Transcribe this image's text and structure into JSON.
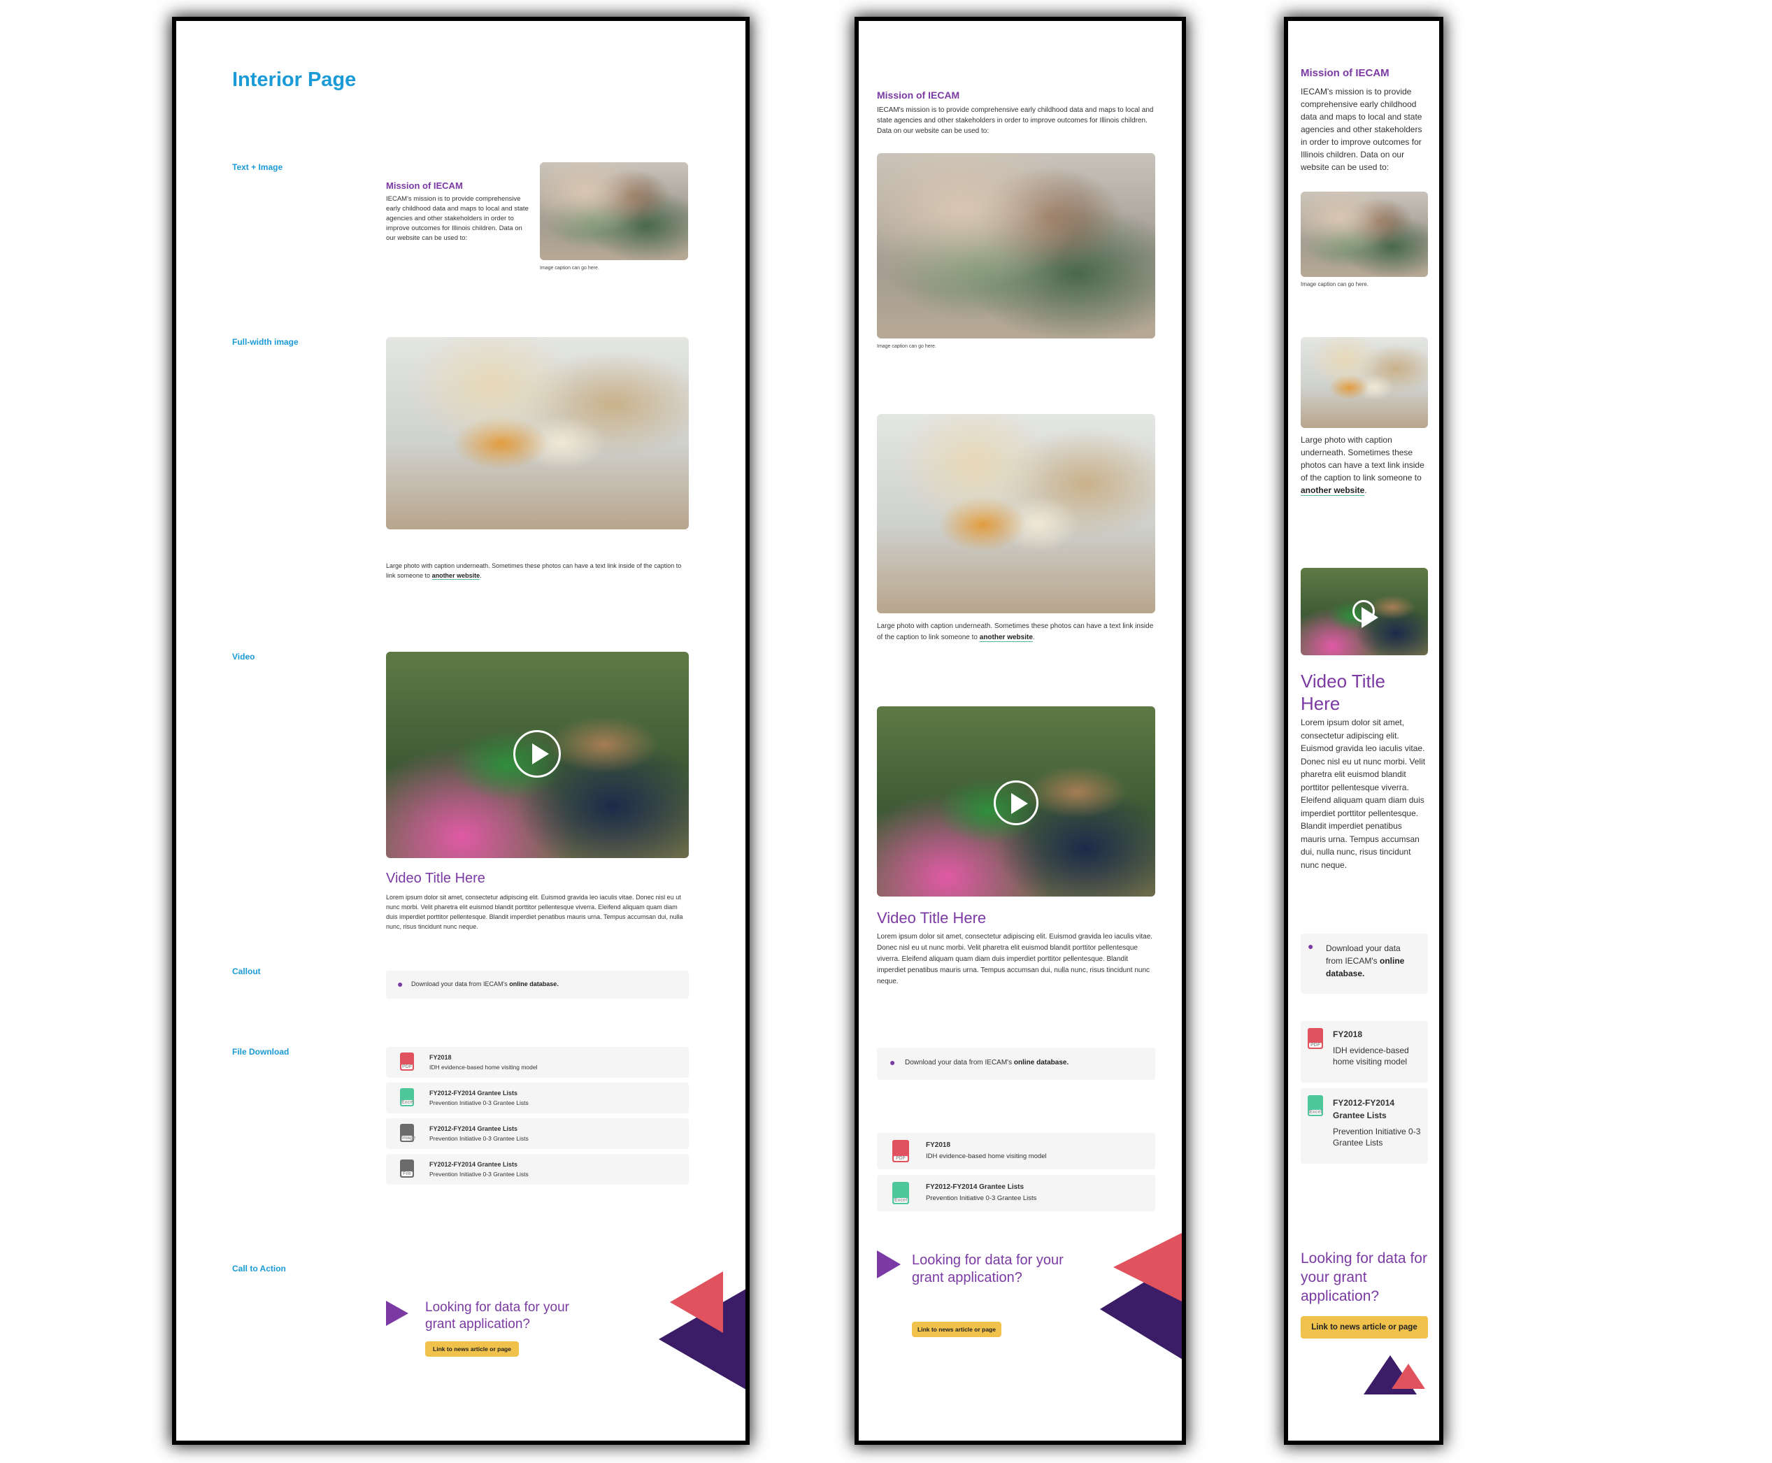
{
  "page_title": "Interior Page",
  "labels": {
    "text_image": "Text + Image",
    "full_width_image": "Full-width image",
    "video": "Video",
    "callout": "Callout",
    "file_download": "File Download",
    "call_to_action": "Call to Action"
  },
  "mission": {
    "title": "Mission of IECAM",
    "body": "IECAM's mission is to provide comprehensive early childhood data and maps to local and state agencies and other stakeholders in order to improve outcomes for Illinois children. Data on our website can be used to:",
    "caption": "Image caption can go here."
  },
  "full_image": {
    "caption_prefix": "Large photo with caption underneath. Sometimes these photos can have a text link inside of the caption to link someone to",
    "caption_link": "another website",
    "caption_suffix": "."
  },
  "video": {
    "title": "Video Title Here",
    "body": "Lorem ipsum dolor sit amet, consectetur adipiscing elit. Euismod gravida leo iaculis vitae. Donec nisl eu ut nunc morbi. Velit pharetra elit euismod blandit porttitor pellentesque viverra. Eleifend aliquam quam diam duis imperdiet porttitor pellentesque. Blandit imperdiet penatibus mauris urna. Tempus accumsan dui, nulla nunc, risus tincidunt nunc neque."
  },
  "callout": {
    "prefix": "Download your data from IECAM's",
    "link": "online database."
  },
  "files": [
    {
      "title": "FY2018",
      "subtitle": "IDH evidence-based home visiting model",
      "type": "PDF",
      "color": "#e0525e"
    },
    {
      "title": "FY2012-FY2014 Grantee Lists",
      "subtitle": "Prevention Initiative 0-3 Grantee Lists",
      "type": "Excel",
      "color": "#4ec79a"
    },
    {
      "title": "FY2012-FY2014 Grantee Lists",
      "subtitle": "Prevention Initiative 0-3 Grantee Lists",
      "type": "Image",
      "color": "#6b6b6b"
    },
    {
      "title": "FY2012-FY2014 Grantee Lists",
      "subtitle": "Prevention Initiative 0-3 Grantee Lists",
      "type": "File",
      "color": "#6b6b6b"
    }
  ],
  "cta": {
    "heading": "Looking for data for your grant application?",
    "button": "Link to news article or page"
  },
  "colors": {
    "purple": "#7b3aa3",
    "blue": "#1a9ad6",
    "coral": "#e0525e",
    "dark_purple": "#3a1d66",
    "yellow": "#f0c24b"
  }
}
